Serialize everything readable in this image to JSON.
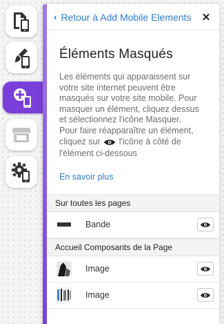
{
  "colors": {
    "accent": "#7a3fd8",
    "link": "#2f7cd3",
    "text": "#222222",
    "muted": "#6c6c6c"
  },
  "rail": {
    "items": [
      {
        "icon": "mobile-page-icon",
        "active": false,
        "enabled": true
      },
      {
        "icon": "paint-brush-mobile-icon",
        "active": false,
        "enabled": true
      },
      {
        "icon": "add-elements-mobile-icon",
        "active": true,
        "enabled": true
      },
      {
        "icon": "store-icon",
        "active": false,
        "enabled": false
      },
      {
        "icon": "gear-mobile-icon",
        "active": false,
        "enabled": true
      }
    ]
  },
  "header": {
    "back_label": "Retour à Add Mobile Elements",
    "back_icon": "chevron-left-icon",
    "close_icon": "close-icon"
  },
  "main": {
    "title": "Éléments Masqués",
    "description_part1": "Les éléments qui apparaissent sur votre site internet peuvent être masqués sur votre site mobile. Pour masquer un élément, cliquez dessus et sélectionnez l'icône Masquer.",
    "description_part2": "Pour faire réapparaître un élément, cliquez sur",
    "description_part3": "l'icône à côté de l'élément ci-dessous",
    "learn_more": "En savoir plus"
  },
  "sections": [
    {
      "heading": "Sur toutes les pages",
      "items": [
        {
          "label": "Bande",
          "thumb": "strip-thumb"
        }
      ]
    },
    {
      "heading": "Accueil Composants de la Page",
      "items": [
        {
          "label": "Image",
          "thumb": "image-thumb"
        },
        {
          "label": "Image",
          "thumb": "image-thumb"
        }
      ]
    }
  ]
}
